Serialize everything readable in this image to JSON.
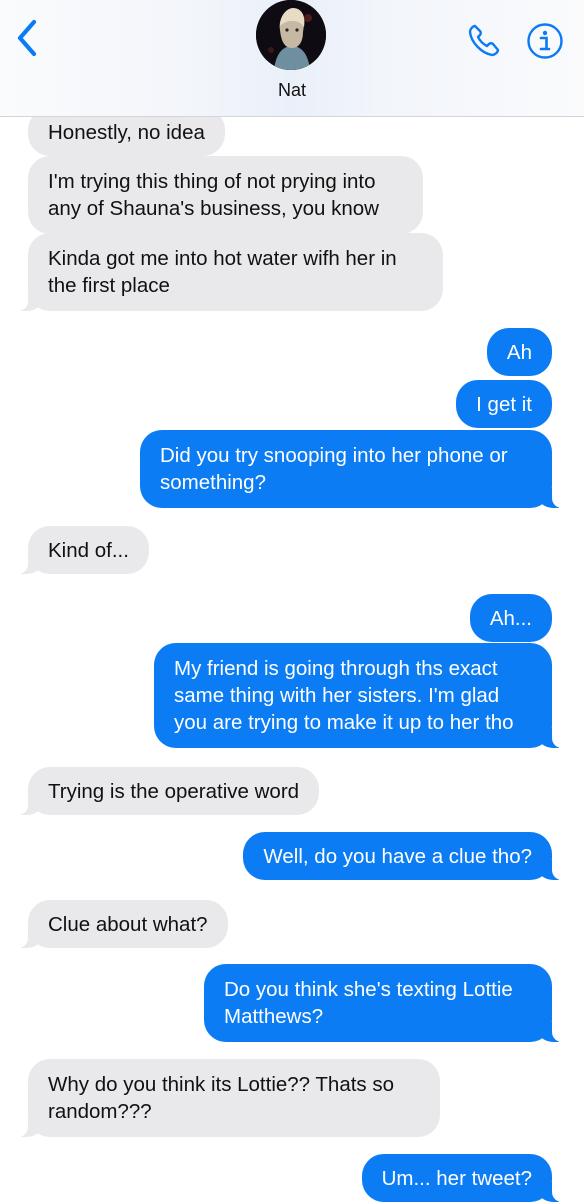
{
  "header": {
    "contact_name": "Nat",
    "back_icon": "chevron-left-icon",
    "call_icon": "phone-icon",
    "info_icon": "info-icon"
  },
  "colors": {
    "incoming_bubble": "#e9e9eb",
    "outgoing_bubble": "#0b7cf3",
    "accent": "#0a7af5"
  },
  "messages": [
    {
      "from": "contact",
      "text": "Honestly, no idea"
    },
    {
      "from": "contact",
      "text": "I'm trying this thing of not prying into any of Shauna's business, you know"
    },
    {
      "from": "contact",
      "text": "Kinda got me into hot water wifh her in the first place"
    },
    {
      "from": "me",
      "text": "Ah"
    },
    {
      "from": "me",
      "text": "I get it"
    },
    {
      "from": "me",
      "text": "Did you try snooping into her phone or something?"
    },
    {
      "from": "contact",
      "text": "Kind of..."
    },
    {
      "from": "me",
      "text": "Ah..."
    },
    {
      "from": "me",
      "text": "My friend is going through ths exact same thing with her sisters. I'm glad you are trying to make it up to her tho"
    },
    {
      "from": "contact",
      "text": "Trying is the operative word"
    },
    {
      "from": "me",
      "text": "Well, do you have a clue tho?"
    },
    {
      "from": "contact",
      "text": "Clue about what?"
    },
    {
      "from": "me",
      "text": "Do you think she's texting Lottie Matthews?"
    },
    {
      "from": "contact",
      "text": "Why do you think its Lottie?? Thats so random???"
    },
    {
      "from": "me",
      "text": "Um... her tweet?"
    }
  ]
}
